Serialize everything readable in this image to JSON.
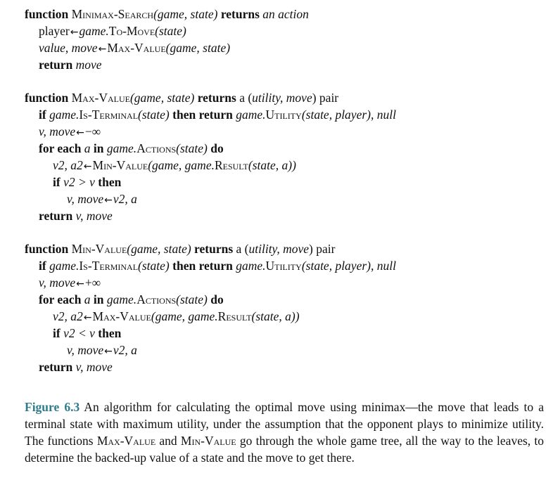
{
  "search": {
    "fn_kw": "function",
    "name": "Minimax-Search",
    "params": "(game, state)",
    "returns_kw": "returns",
    "returns_text": "an action",
    "l1_lhs": "player",
    "l1_game": "game.",
    "l1_call": "To-Move",
    "l1_args": "(state)",
    "l2_lhs": "value, move",
    "l2_call": "Max-Value",
    "l2_args": "(game, state)",
    "l3_kw": "return",
    "l3_val": "move"
  },
  "maxv": {
    "fn_kw": "function",
    "name": "Max-Value",
    "params": "(game, state)",
    "returns_kw": "returns",
    "returns_a": "a (",
    "returns_util": "utility, move",
    "returns_end": ") pair",
    "if_kw": "if",
    "if_game": "game.",
    "if_call": "Is-Terminal",
    "if_args": "(state)",
    "then_kw": "then return",
    "util_game": "game.",
    "util_call": "Utility",
    "util_args": "(state, player), null",
    "init_lhs": "v, move",
    "init_val": "−∞",
    "for_kw": "for each",
    "for_var": "a",
    "in_kw": "in",
    "for_game": "game.",
    "for_call": "Actions",
    "for_args": "(state)",
    "do_kw": "do",
    "assign_lhs": "v2, a2",
    "assign_call": "Min-Value",
    "assign_args1": "(game, game.",
    "assign_call2": "Result",
    "assign_args2": "(state, a))",
    "if2_kw": "if",
    "if2_cond": "v2 > v",
    "then2_kw": "then",
    "upd_lhs": "v, move",
    "upd_rhs": "v2, a",
    "ret_kw": "return",
    "ret_val": "v, move"
  },
  "minv": {
    "fn_kw": "function",
    "name": "Min-Value",
    "params": "(game, state)",
    "returns_kw": "returns",
    "returns_a": "a (",
    "returns_util": "utility, move",
    "returns_end": ") pair",
    "if_kw": "if",
    "if_game": "game.",
    "if_call": "Is-Terminal",
    "if_args": "(state)",
    "then_kw": "then return",
    "util_game": "game.",
    "util_call": "Utility",
    "util_args": "(state, player), null",
    "init_lhs": "v, move",
    "init_val": "+∞",
    "for_kw": "for each",
    "for_var": "a",
    "in_kw": "in",
    "for_game": "game.",
    "for_call": "Actions",
    "for_args": "(state)",
    "do_kw": "do",
    "assign_lhs": "v2, a2",
    "assign_call": "Max-Value",
    "assign_args1": "(game, game.",
    "assign_call2": "Result",
    "assign_args2": "(state, a))",
    "if2_kw": "if",
    "if2_cond": "v2 < v",
    "then2_kw": "then",
    "upd_lhs": "v, move",
    "upd_rhs": "v2, a",
    "ret_kw": "return",
    "ret_val": "v, move"
  },
  "caption": {
    "label": "Figure 6.3",
    "text1": " An algorithm for calculating the optimal move using minimax—the move that leads to a terminal state with maximum utility, under the assumption that the opponent plays to minimize utility.  The functions ",
    "max_name": "Max-Value",
    "and": " and ",
    "min_name": "Min-Value",
    "text2": " go through the whole game tree, all the way to the leaves, to determine the backed-up value of a state and the move to get there."
  },
  "colors": {
    "figure_label": "#2e7d8c",
    "text": "#111111"
  }
}
